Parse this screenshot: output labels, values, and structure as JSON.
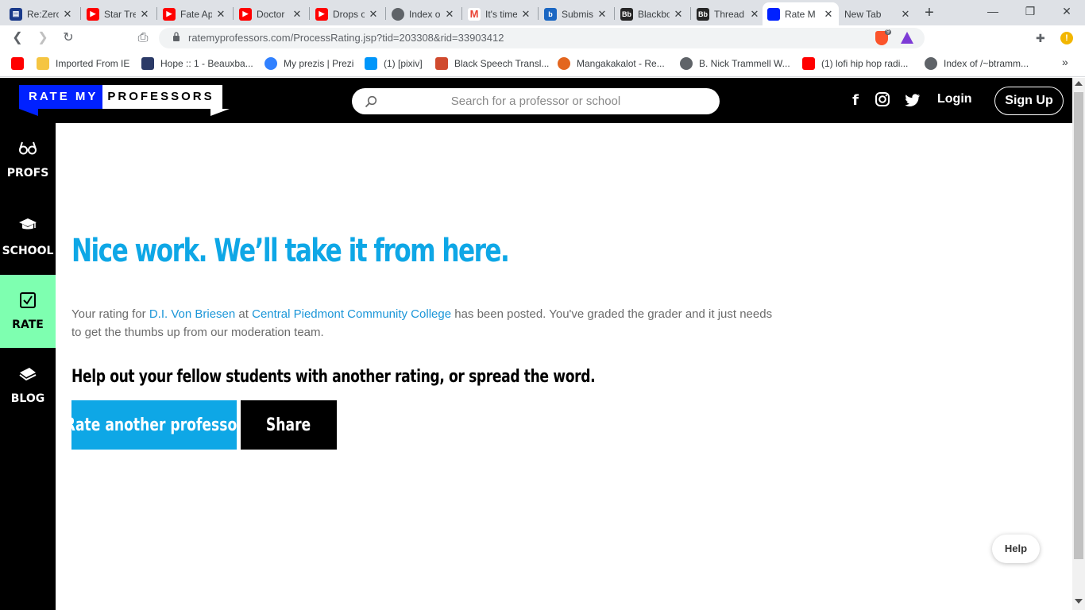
{
  "browser": {
    "tabs": [
      {
        "title": "Re:Zero",
        "favicon": "book-icon",
        "color": "#1a3a8a"
      },
      {
        "title": "Star Tre",
        "favicon": "youtube-icon",
        "color": "#ff0000"
      },
      {
        "title": "Fate Ap",
        "favicon": "youtube-icon",
        "color": "#ff0000"
      },
      {
        "title": "Doctor",
        "favicon": "youtube-icon",
        "color": "#ff0000"
      },
      {
        "title": "Drops o",
        "favicon": "youtube-icon",
        "color": "#ff0000"
      },
      {
        "title": "Index o",
        "favicon": "globe-icon",
        "color": "#5f6368"
      },
      {
        "title": "It's time",
        "favicon": "gmail-icon",
        "color": "#ea4335"
      },
      {
        "title": "Submis",
        "favicon": "b-icon",
        "color": "#1a66c2"
      },
      {
        "title": "Blackbo",
        "favicon": "blackboard-icon",
        "color": "#262626"
      },
      {
        "title": "Thread",
        "favicon": "blackboard-icon",
        "color": "#262626"
      },
      {
        "title": "Rate M",
        "favicon": "rmp-icon",
        "color": "#0021ff"
      },
      {
        "title": "New Tab",
        "favicon": "",
        "color": ""
      }
    ],
    "url": "ratemyprofessors.com/ProcessRating.jsp?tid=203308&rid=33903412",
    "brave_badge": "9",
    "alert": "!",
    "bookmarks": [
      {
        "label": "",
        "favicon": "youtube-icon",
        "color": "#ff0000"
      },
      {
        "label": "Imported From IE",
        "favicon": "folder-icon",
        "color": "#f5c542"
      },
      {
        "label": "Hope :: 1 - Beauxba...",
        "favicon": "fa-icon",
        "color": "#2b3a67"
      },
      {
        "label": "My prezis | Prezi",
        "favicon": "prezi-icon",
        "color": "#3181ff"
      },
      {
        "label": "(1) [pixiv]",
        "favicon": "pixiv-icon",
        "color": "#0096fa"
      },
      {
        "label": "Black Speech Transl...",
        "favicon": "jar-icon",
        "color": "#d04a2e"
      },
      {
        "label": "Mangakakalot - Re...",
        "favicon": "manga-icon",
        "color": "#e3661f"
      },
      {
        "label": "B. Nick Trammell W...",
        "favicon": "globe-icon",
        "color": "#5f6368"
      },
      {
        "label": "(1) lofi hip hop radi...",
        "favicon": "youtube-icon",
        "color": "#ff0000"
      },
      {
        "label": "Index of /~btramm...",
        "favicon": "globe-icon",
        "color": "#5f6368"
      }
    ]
  },
  "site": {
    "logo_part1": "RATE MY",
    "logo_part2": "PROFESSORS",
    "search_placeholder": "Search for a professor or school",
    "login": "Login",
    "signup": "Sign Up",
    "nav": [
      {
        "label": "PROFS",
        "icon": "glasses-icon"
      },
      {
        "label": "SCHOOL",
        "icon": "graduation-cap-icon"
      },
      {
        "label": "RATE",
        "icon": "checkbox-icon"
      },
      {
        "label": "BLOG",
        "icon": "book-icon"
      }
    ],
    "headline": "Nice work. We’ll take it from here.",
    "desc_prefix": "Your rating for ",
    "professor": "D.I. Von Briesen",
    "desc_at": " at ",
    "school": "Central Piedmont Community College",
    "desc_suffix": " has been posted. You've graded the grader and it just needs to get the thumbs up from our moderation team.",
    "subhead": "Help out your fellow students with another rating, or spread the word.",
    "rate_another": "Rate another professor",
    "share": "Share",
    "help": "Help",
    "colors": {
      "accent_blue": "#0ea7e6",
      "logo_blue": "#0021ff",
      "active_nav": "#7effb0"
    }
  }
}
